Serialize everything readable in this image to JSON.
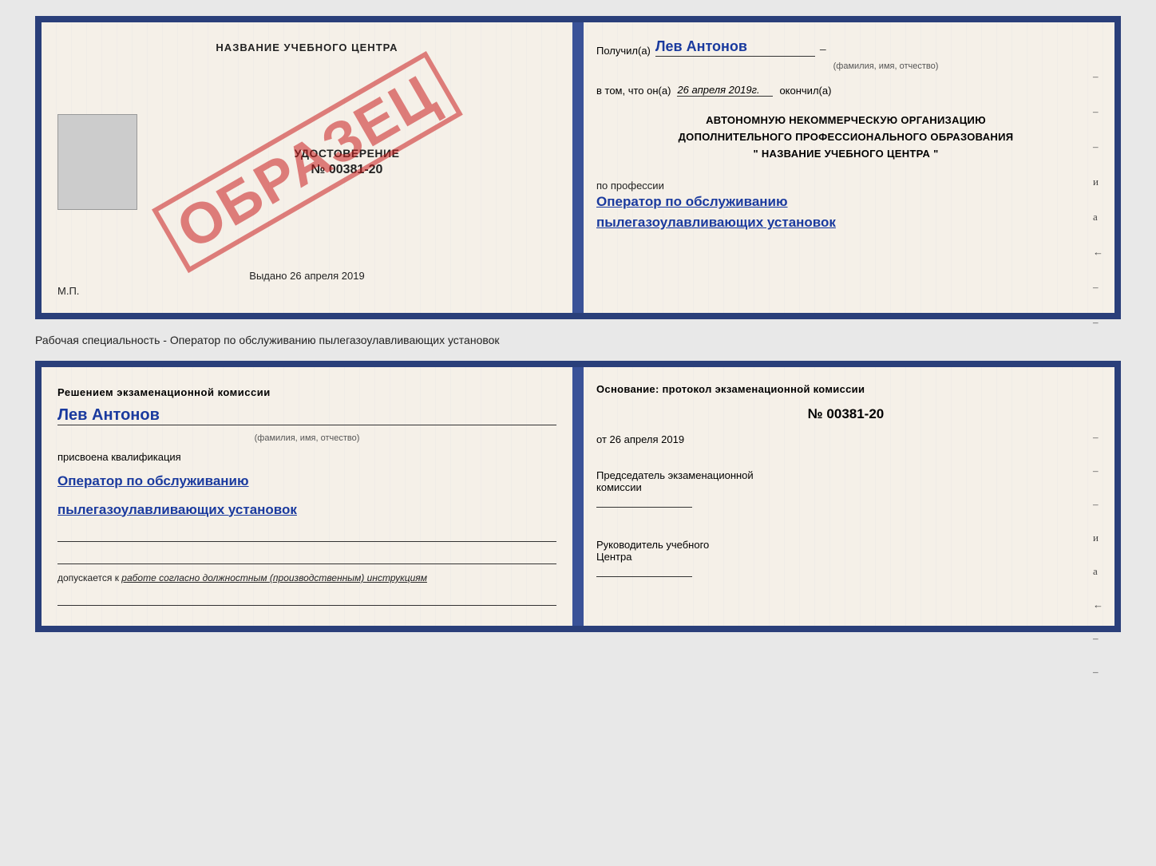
{
  "top_cert": {
    "left": {
      "title": "НАЗВАНИЕ УЧЕБНОГО ЦЕНТРА",
      "udostoverenie_label": "УДОСТОВЕРЕНИЕ",
      "cert_number": "№ 00381-20",
      "obrazec": "ОБРАЗЕЦ",
      "issued_label": "Выдано",
      "issued_date": "26 апреля 2019",
      "mp_label": "М.П."
    },
    "right": {
      "recipient_label": "Получил(а)",
      "recipient_name": "Лев Антонов",
      "recipient_subtitle": "(фамилия, имя, отчество)",
      "recipient_dash": "–",
      "date_prefix": "в том, что он(а)",
      "date_value": "26 апреля 2019г.",
      "date_suffix": "окончил(а)",
      "org_line1": "АВТОНОМНУЮ НЕКОММЕРЧЕСКУЮ ОРГАНИЗАЦИЮ",
      "org_line2": "ДОПОЛНИТЕЛЬНОГО ПРОФЕССИОНАЛЬНОГО ОБРАЗОВАНИЯ",
      "org_line3": "\"   НАЗВАНИЕ УЧЕБНОГО ЦЕНТРА   \"",
      "profession_label": "по профессии",
      "profession_line1": "Оператор по обслуживанию",
      "profession_line2": "пылегазоулавливающих установок",
      "dashes": [
        "–",
        "–",
        "–",
        "и",
        "а",
        "←",
        "–",
        "–",
        "–"
      ]
    }
  },
  "separator": {
    "text": "Рабочая специальность - Оператор по обслуживанию пылегазоулавливающих установок"
  },
  "bottom_cert": {
    "left": {
      "decision_label": "Решением экзаменационной комиссии",
      "name": "Лев Антонов",
      "name_subtitle": "(фамилия, имя, отчество)",
      "qualification_label": "присвоена квалификация",
      "qualification_line1": "Оператор по обслуживанию",
      "qualification_line2": "пылегазоулавливающих установок",
      "допускается_prefix": "допускается к",
      "допускается_value": "работе согласно должностным (производственным) инструкциям"
    },
    "right": {
      "osnование_label": "Основание: протокол экзаменационной комиссии",
      "protocol_number": "№ 00381-20",
      "protocol_date_prefix": "от",
      "protocol_date": "26 апреля 2019",
      "predsedatel_line1": "Председатель экзаменационной",
      "predsedatel_line2": "комиссии",
      "rukovoditel_line1": "Руководитель учебного",
      "rukovoditel_line2": "Центра",
      "dashes": [
        "–",
        "–",
        "–",
        "и",
        "а",
        "←",
        "–",
        "–"
      ]
    }
  }
}
